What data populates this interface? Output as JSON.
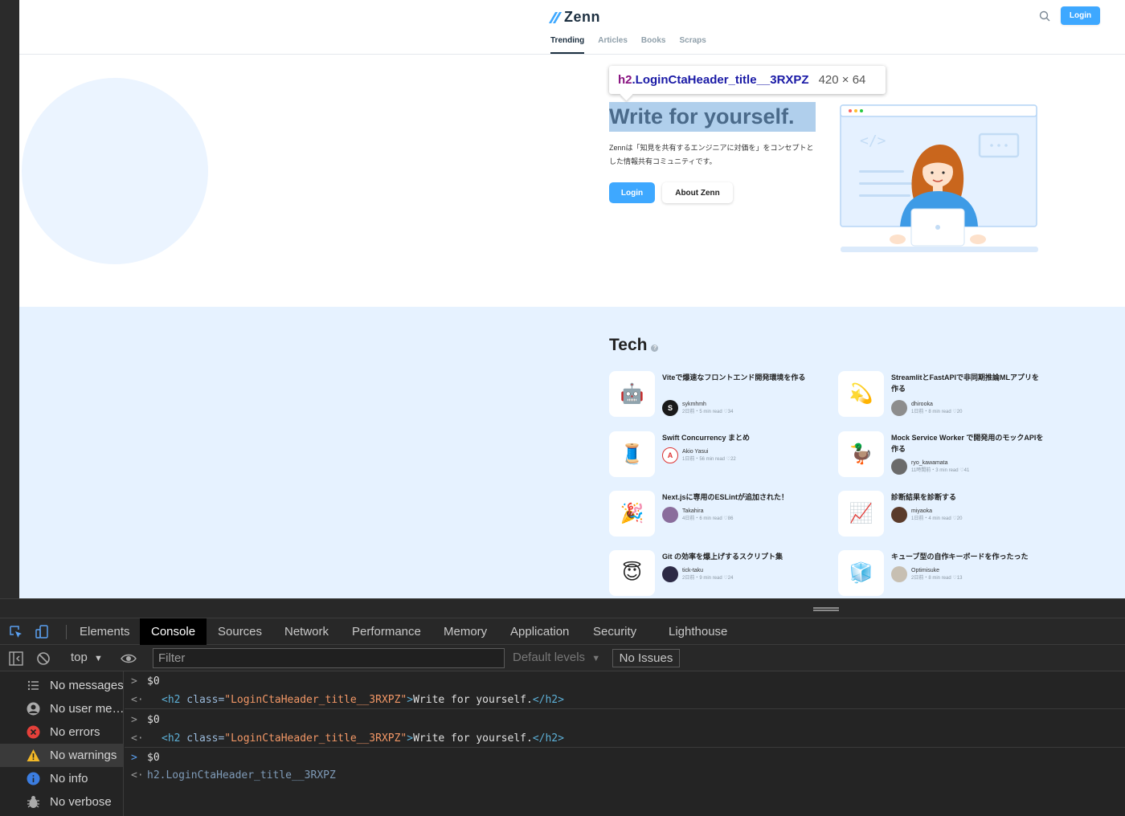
{
  "site": {
    "logo_text": "Zenn",
    "header_login": "Login",
    "nav_tabs": [
      "Trending",
      "Articles",
      "Books",
      "Scraps"
    ]
  },
  "tooltip": {
    "tag": "h2",
    "class_name": ".LoginCtaHeader_title__3RXPZ",
    "size": "420 × 64"
  },
  "hero": {
    "title": "Write for yourself.",
    "description": "Zennは「知見を共有するエンジニアに対価を」をコンセプトとした情報共有コミュニティです。",
    "login_label": "Login",
    "about_label": "About Zenn"
  },
  "tech": {
    "title": "Tech",
    "help": "?",
    "articles": [
      {
        "emoji": "🤖",
        "title": "Viteで爆速なフロントエンド開発環境を作る",
        "author": "sykmhmh",
        "avatar": "S",
        "stats": "2日前・5 min read ♡34"
      },
      {
        "emoji": "💫",
        "title": "StreamlitとFastAPIで非同期推論MLアプリを作る",
        "author": "dhirooka",
        "avatar": "",
        "stats": "1日前・8 min read ♡20"
      },
      {
        "emoji": "🧵",
        "title": "Swift Concurrency まとめ",
        "author": "Akio Yasui",
        "avatar": "A",
        "stats": "1日前・56 min read ♡22"
      },
      {
        "emoji": "🦆",
        "title": "Mock Service Worker で開発用のモックAPIを作る",
        "author": "ryo_kawamata",
        "avatar": "",
        "stats": "11時間前・3 min read ♡41"
      },
      {
        "emoji": "🎉",
        "title": "Next.jsに専用のESLintが追加された！",
        "author": "Takahira",
        "avatar": "",
        "stats": "4日前・6 min read ♡86"
      },
      {
        "emoji": "📈",
        "title": "診断結果を診断する",
        "author": "miyaoka",
        "avatar": "",
        "stats": "1日前・4 min read ♡20"
      },
      {
        "emoji": "😇",
        "title": "Git の効率を爆上げするスクリプト集",
        "author": "tick-taku",
        "avatar": "",
        "stats": "2日前・9 min read ♡24"
      },
      {
        "emoji": "🧊",
        "title": "キューブ型の自作キーボードを作ったった",
        "author": "Optimisuke",
        "avatar": "",
        "stats": "2日前・8 min read ♡13"
      }
    ]
  },
  "devtools": {
    "tabs": [
      "Elements",
      "Console",
      "Sources",
      "Network",
      "Performance",
      "Memory",
      "Application",
      "Security",
      "Lighthouse"
    ],
    "active_tab": "Console",
    "context": "top",
    "filter_placeholder": "Filter",
    "levels": "Default levels",
    "issues": "No Issues",
    "sidebar": [
      {
        "icon": "list-icon",
        "label": "No messages"
      },
      {
        "icon": "user-icon",
        "label": "No user me…"
      },
      {
        "icon": "error-icon",
        "label": "No errors"
      },
      {
        "icon": "warning-icon",
        "label": "No warnings"
      },
      {
        "icon": "info-icon",
        "label": "No info"
      },
      {
        "icon": "verbose-icon",
        "label": "No verbose"
      }
    ],
    "console_lines": [
      {
        "prompt": ">",
        "text": "$0"
      },
      {
        "prompt": "<·",
        "open_tag": "<h2",
        "attr": " class=",
        "value": "\"LoginCtaHeader_title__3RXPZ\"",
        "close": ">",
        "content": "Write for yourself.",
        "end_tag": "</h2>"
      },
      {
        "prompt": ">",
        "text": "$0"
      },
      {
        "prompt": "<·",
        "open_tag": "<h2",
        "attr": " class=",
        "value": "\"LoginCtaHeader_title__3RXPZ\"",
        "close": ">",
        "content": "Write for yourself.",
        "end_tag": "</h2>"
      },
      {
        "prompt": ">",
        "text": "$0"
      },
      {
        "prompt": "<·",
        "text": "h2.LoginCtaHeader_title__3RXPZ"
      }
    ]
  }
}
